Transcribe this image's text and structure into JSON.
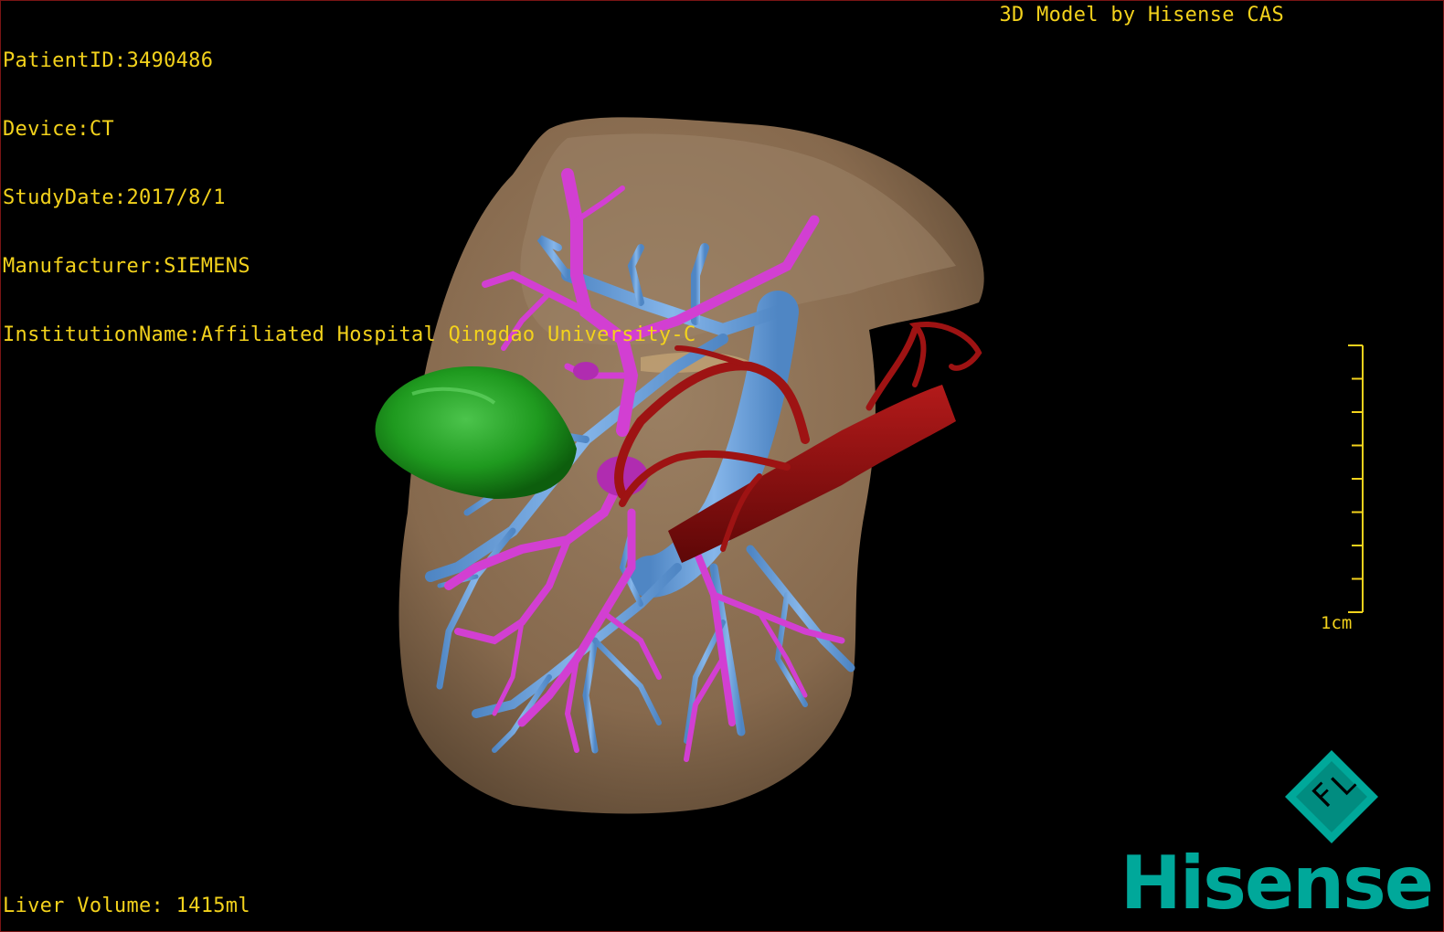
{
  "overlay": {
    "info_lines": [
      "PatientID:3490486",
      "Device:CT",
      "StudyDate:2017/8/1",
      "Manufacturer:SIEMENS",
      "InstitutionName:Affiliated Hospital Qingdao University-C"
    ],
    "credit": "3D Model by Hisense CAS",
    "volume": "Liver Volume: 1415ml"
  },
  "scale": {
    "label": "1cm",
    "tick_count": 9
  },
  "orientation": {
    "letters": [
      "F",
      "L"
    ]
  },
  "brand": {
    "name": "Hisense"
  },
  "colors": {
    "text": "#f3d21c",
    "liver": "#8d7358",
    "portal_vein": "#6a9fd8",
    "hepatic_vein": "#d23fd2",
    "artery": "#8c0f0f",
    "lesion": "#1f9a1f",
    "brand": "#00a89a",
    "frame": "#7a1414"
  },
  "structures": [
    {
      "name": "liver",
      "icon": "liver-surface"
    },
    {
      "name": "gallbladder-lesion",
      "icon": "green-mass"
    },
    {
      "name": "portal-vein",
      "icon": "blue-vessel-tree"
    },
    {
      "name": "hepatic-vein",
      "icon": "magenta-vessel-tree"
    },
    {
      "name": "aorta",
      "icon": "red-artery"
    }
  ]
}
